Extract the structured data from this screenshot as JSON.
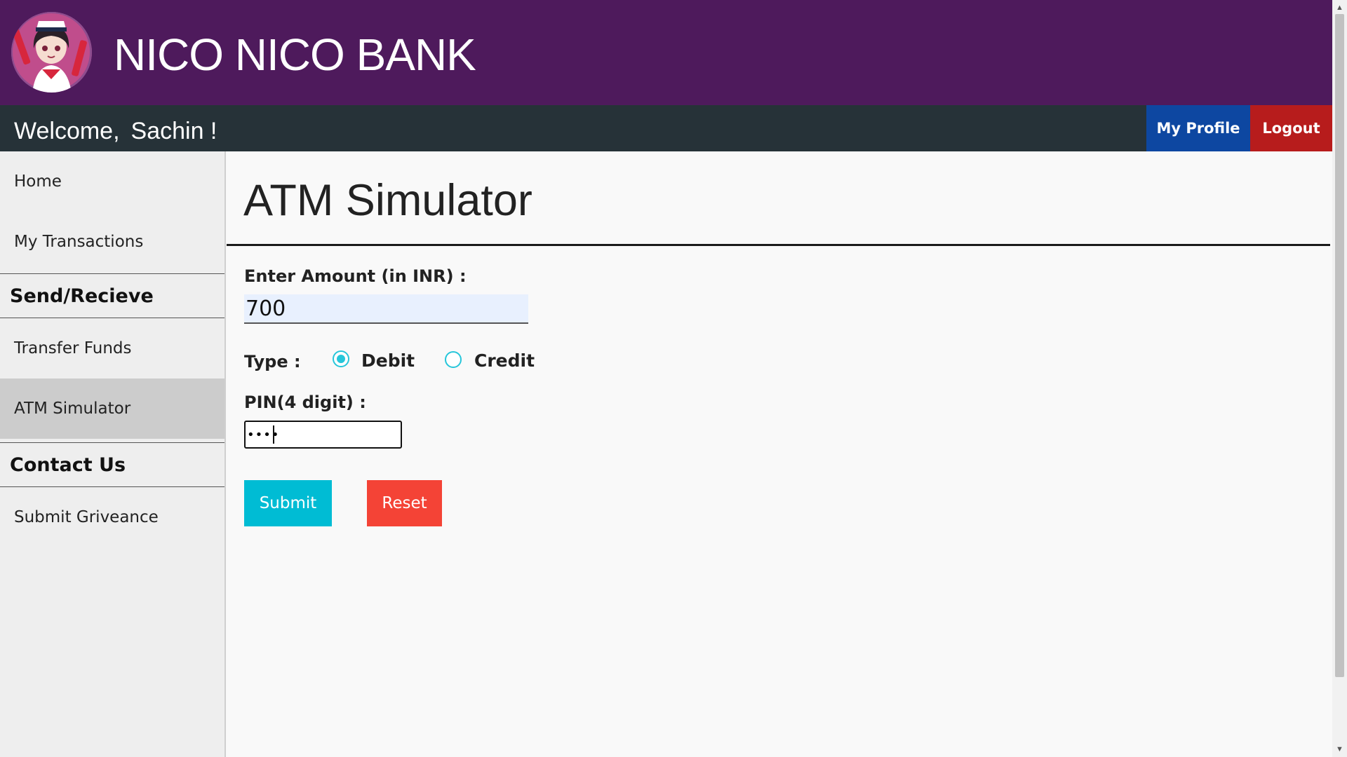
{
  "header": {
    "bank_name": "NICO NICO BANK",
    "logo_icon": "anime-girl-avatar-logo",
    "colors": {
      "brand": "#4e1a5c",
      "bar": "#263238"
    }
  },
  "welcome_bar": {
    "greeting": "Welcome,",
    "user": "Sachin !",
    "profile_button": "My Profile",
    "logout_button": "Logout",
    "colors": {
      "profile": "#0d47a1",
      "logout": "#b71c1c"
    }
  },
  "sidebar": {
    "items": [
      {
        "label": "Home"
      },
      {
        "label": "My Transactions"
      }
    ],
    "sections": [
      {
        "heading": "Send/Recieve",
        "items": [
          {
            "label": "Transfer Funds"
          },
          {
            "label": "ATM Simulator",
            "active": true
          }
        ]
      },
      {
        "heading": "Contact Us",
        "items": [
          {
            "label": "Submit Griveance"
          }
        ]
      }
    ]
  },
  "main": {
    "title": "ATM Simulator",
    "form": {
      "amount_label": "Enter Amount (in INR) :",
      "amount_value": "700",
      "type_label": "Type :",
      "type_options": [
        "Debit",
        "Credit"
      ],
      "type_selected": "Debit",
      "pin_label": "PIN(4 digit) :",
      "pin_value": "1234",
      "submit_label": "Submit",
      "reset_label": "Reset",
      "colors": {
        "submit": "#00bcd4",
        "reset": "#f44336",
        "radio": "#26c6da"
      }
    }
  }
}
